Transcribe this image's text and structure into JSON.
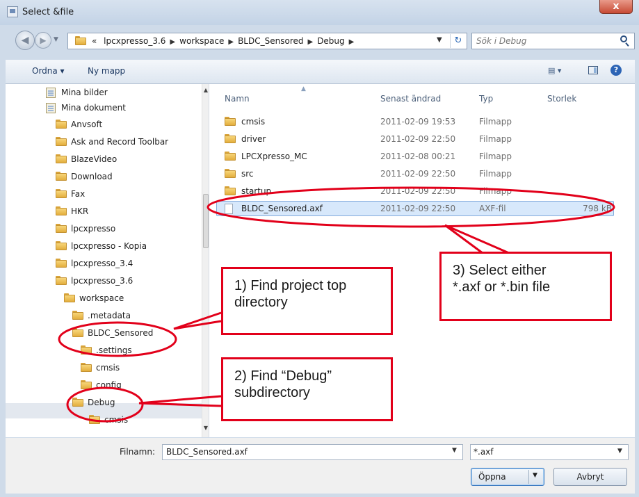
{
  "window": {
    "title": "Select &file",
    "close_label": "x"
  },
  "address": {
    "crumbs": [
      "lpcxpresso_3.6",
      "workspace",
      "BLDC_Sensored",
      "Debug"
    ],
    "prefix": "«",
    "search_placeholder": "Sök i Debug"
  },
  "toolbar": {
    "organize": "Ordna ▾",
    "new_folder": "Ny mapp",
    "view": "▤ ▾",
    "help": "?"
  },
  "tree": {
    "items": [
      {
        "label": "Mina bilder",
        "icon": "library-icon"
      },
      {
        "label": "Mina dokument",
        "icon": "library-icon"
      },
      {
        "label": "Anvsoft",
        "icon": "folder-icon"
      },
      {
        "label": "Ask and Record Toolbar",
        "icon": "folder-icon"
      },
      {
        "label": "BlazeVideo",
        "icon": "folder-icon"
      },
      {
        "label": "Download",
        "icon": "folder-icon"
      },
      {
        "label": "Fax",
        "icon": "folder-icon"
      },
      {
        "label": "HKR",
        "icon": "folder-icon"
      },
      {
        "label": "lpcxpresso",
        "icon": "folder-icon"
      },
      {
        "label": "lpcxpresso - Kopia",
        "icon": "folder-icon"
      },
      {
        "label": "lpcxpresso_3.4",
        "icon": "folder-icon"
      },
      {
        "label": "lpcxpresso_3.6",
        "icon": "folder-icon"
      },
      {
        "label": "workspace",
        "icon": "folder-icon"
      },
      {
        "label": ".metadata",
        "icon": "folder-icon"
      },
      {
        "label": "BLDC_Sensored",
        "icon": "folder-icon"
      },
      {
        "label": ".settings",
        "icon": "folder-icon"
      },
      {
        "label": "cmsis",
        "icon": "folder-icon"
      },
      {
        "label": "config",
        "icon": "folder-icon"
      },
      {
        "label": "Debug",
        "icon": "folder-icon"
      },
      {
        "label": "cmsis",
        "icon": "folder-icon"
      }
    ]
  },
  "files": {
    "columns": {
      "name": "Namn",
      "date": "Senast ändrad",
      "type": "Typ",
      "size": "Storlek"
    },
    "rows": [
      {
        "name": "cmsis",
        "date": "2011-02-09 19:53",
        "type": "Filmapp",
        "size": ""
      },
      {
        "name": "driver",
        "date": "2011-02-09 22:50",
        "type": "Filmapp",
        "size": ""
      },
      {
        "name": "LPCXpresso_MC",
        "date": "2011-02-08 00:21",
        "type": "Filmapp",
        "size": ""
      },
      {
        "name": "src",
        "date": "2011-02-09 22:50",
        "type": "Filmapp",
        "size": ""
      },
      {
        "name": "startup",
        "date": "2011-02-09 22:50",
        "type": "Filmapp",
        "size": ""
      },
      {
        "name": "BLDC_Sensored.axf",
        "date": "2011-02-09 22:50",
        "type": "AXF-fil",
        "size": "798 kB"
      }
    ],
    "selected_index": 5
  },
  "bottom": {
    "filename_label": "Filnamn:",
    "filename_value": "BLDC_Sensored.axf",
    "filter_value": "*.axf",
    "open_label": "Öppna",
    "cancel_label": "Avbryt"
  },
  "annotations": {
    "callout1": [
      "1) Find project top",
      "directory"
    ],
    "callout2": [
      "2) Find “Debug”",
      "subdirectory"
    ],
    "callout3": [
      "3) Select either",
      "*.axf or *.bin file"
    ],
    "color": "#e2001a"
  }
}
